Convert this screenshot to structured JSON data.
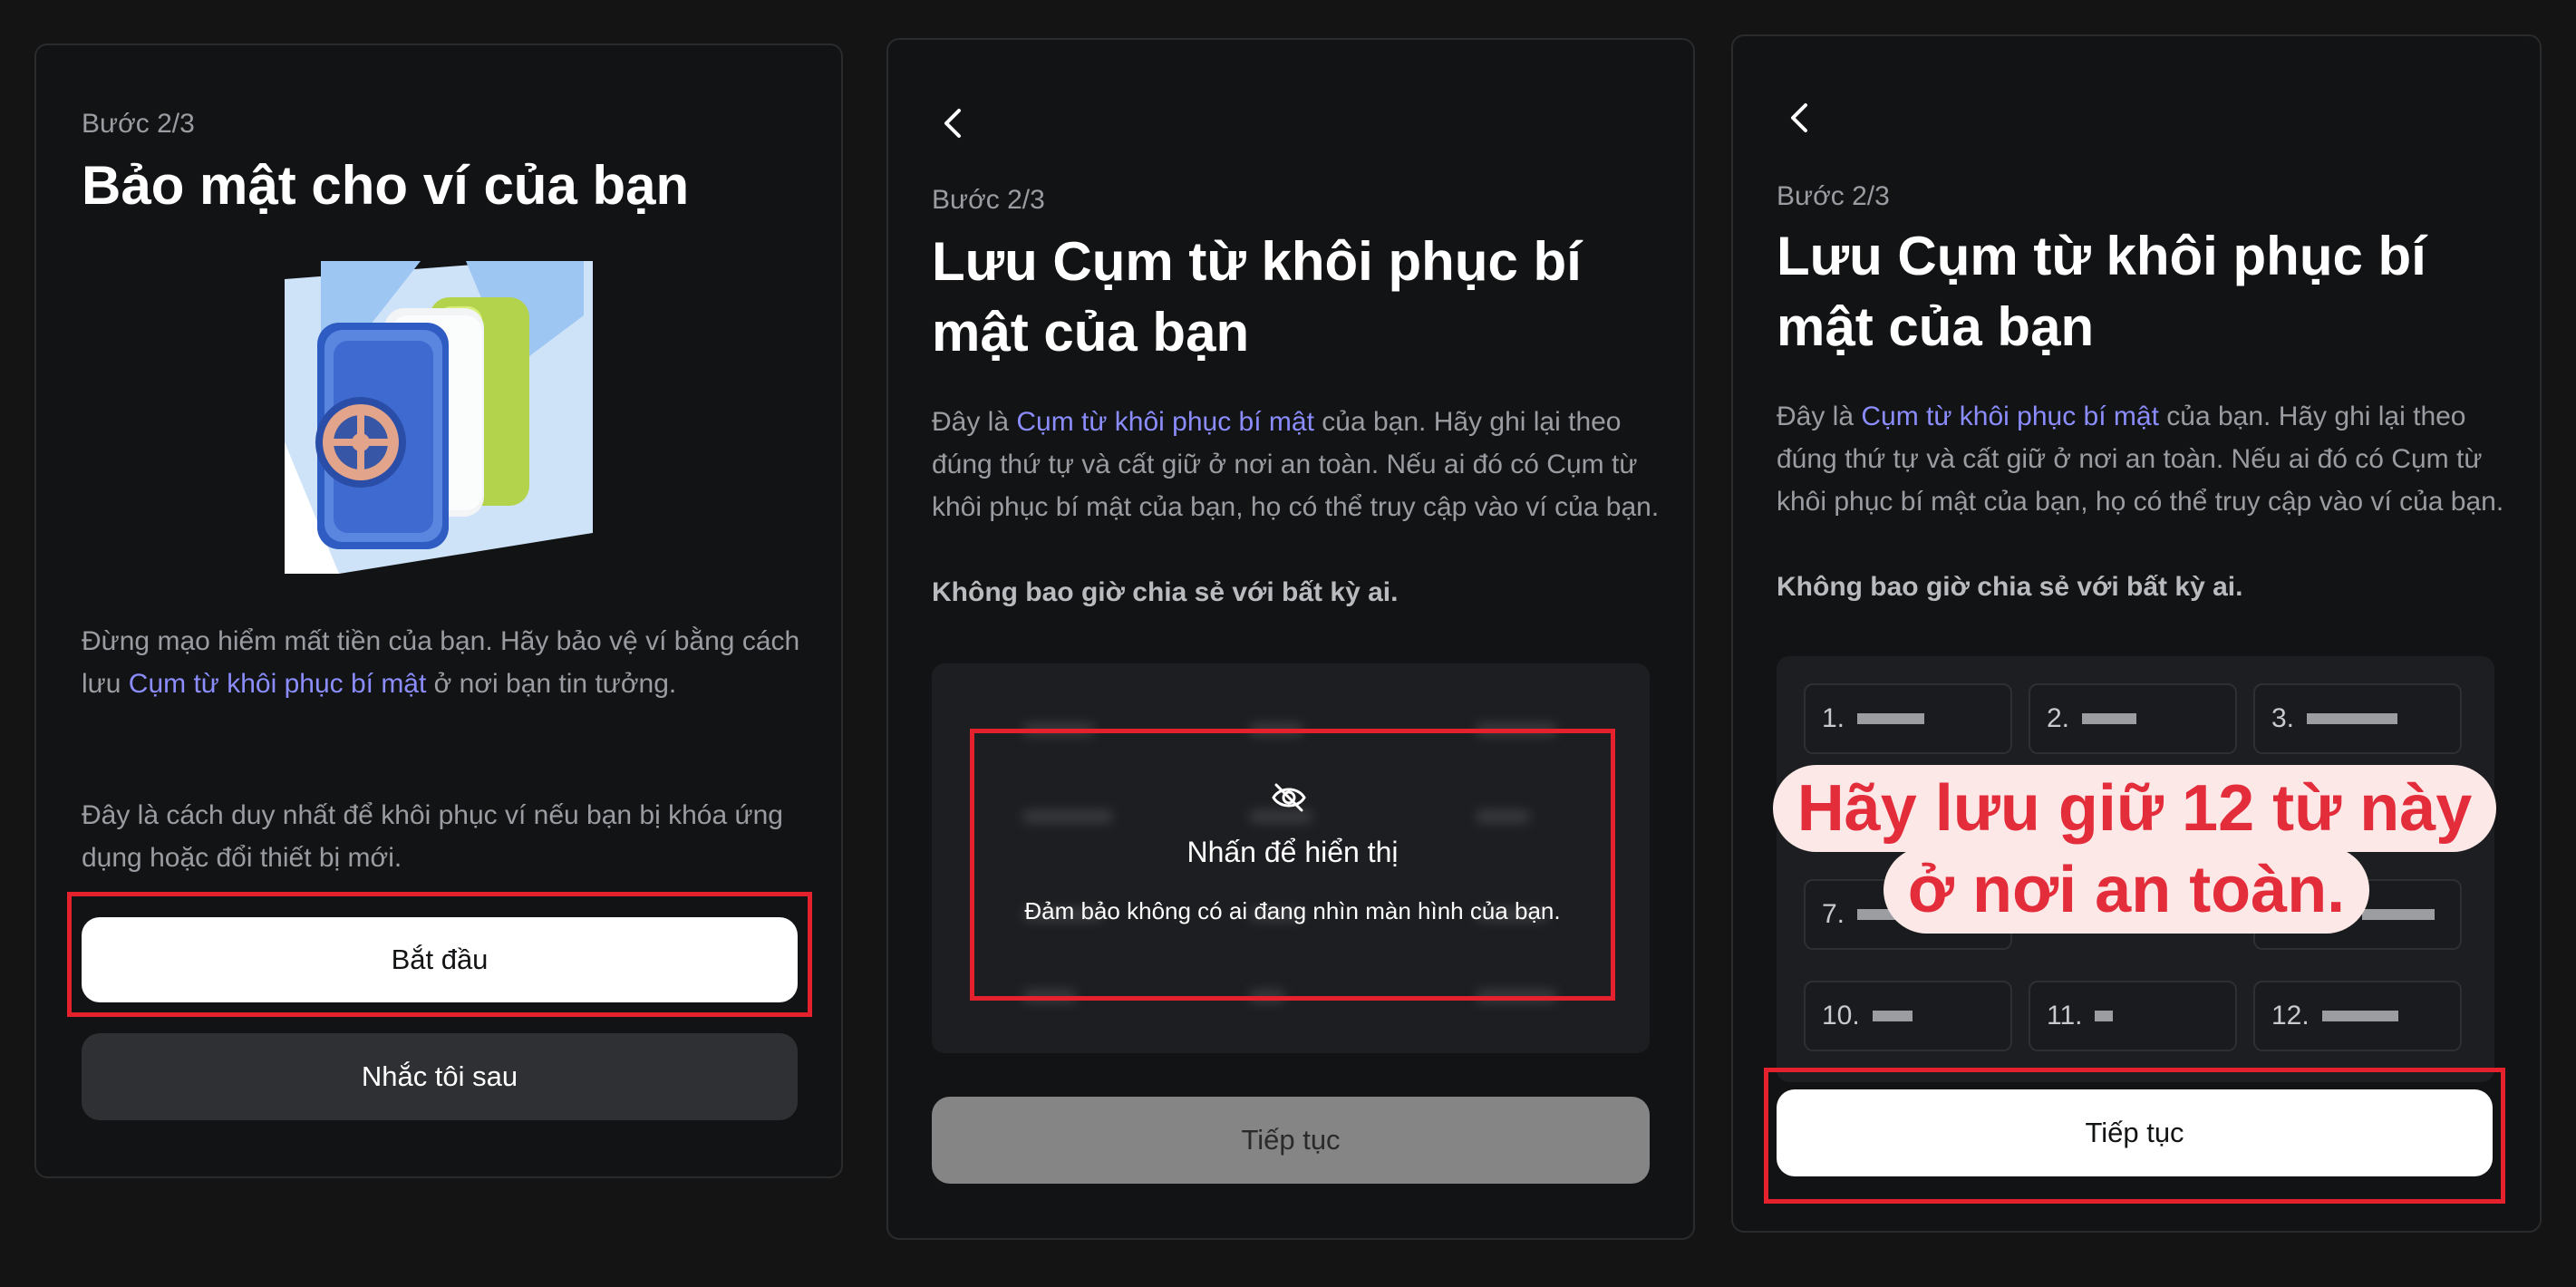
{
  "panel1": {
    "step": "Bước 2/3",
    "title": "Bảo mật cho ví của bạn",
    "para1_pre": "Đừng mạo hiểm mất tiền của bạn. Hãy bảo vệ ví bằng cách lưu ",
    "para1_link": "Cụm từ khôi phục bí mật",
    "para1_post": " ở nơi bạn tin tưởng.",
    "para2": "Đây là cách duy nhất để khôi phục ví nếu bạn bị khóa ứng dụng hoặc đổi thiết bị mới.",
    "start_button": "Bắt đầu",
    "later_button": "Nhắc tôi sau"
  },
  "panel2": {
    "step": "Bước 2/3",
    "title": "Lưu Cụm từ khôi phục bí mật của bạn",
    "intro_pre": "Đây là ",
    "intro_link": "Cụm từ khôi phục bí mật",
    "intro_post": " của bạn. Hãy ghi lại theo đúng thứ tự và cất giữ ở nơi an toàn. Nếu ai đó có Cụm từ khôi phục bí mật của bạn, họ có thể truy cập vào ví của bạn.",
    "warning": "Không bao giờ chia sẻ với bất kỳ ai.",
    "reveal_title": "Nhấn để hiển thị",
    "reveal_note": "Đảm bảo không có ai đang nhìn màn hình của bạn.",
    "continue_button": "Tiếp tục"
  },
  "panel3": {
    "step": "Bước 2/3",
    "title": "Lưu Cụm từ khôi phục bí mật của bạn",
    "intro_pre": "Đây là ",
    "intro_link": "Cụm từ khôi phục bí mật",
    "intro_post": " của bạn. Hãy ghi lại theo đúng thứ tự và cất giữ ở nơi an toàn. Nếu ai đó có Cụm từ khôi phục bí mật của bạn, họ có thể truy cập vào ví của bạn.",
    "warning": "Không bao giờ chia sẻ với bất kỳ ai.",
    "word_labels": [
      "1.",
      "2.",
      "3.",
      "7.",
      "10.",
      "11.",
      "12."
    ],
    "banner_line1": "Hãy lưu giữ 12 từ này",
    "banner_line2": "ở nơi an toàn.",
    "continue_button": "Tiếp tục"
  },
  "colors": {
    "background": "#141414",
    "link": "#8b8dff",
    "highlight": "#e5212e",
    "banner_text": "#e32d3b",
    "banner_bg": "#fde8e8"
  },
  "icons": {
    "back": "chevron-left-icon",
    "reveal": "eye-off-icon",
    "illustration": "vault-illustration"
  }
}
